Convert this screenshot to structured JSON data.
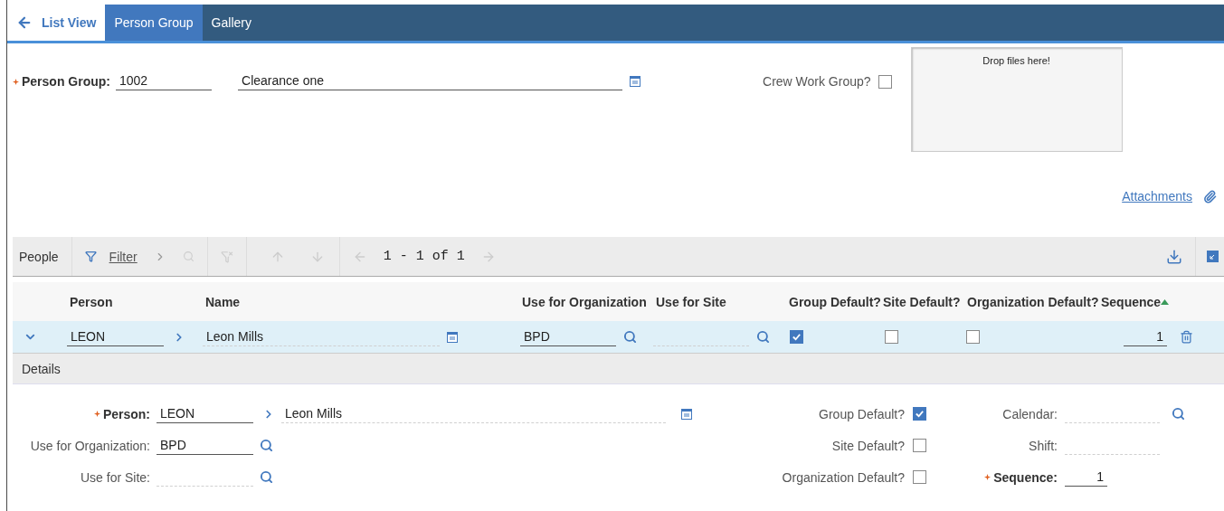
{
  "tabs": [
    {
      "kind": "back",
      "label": "List View",
      "selected": false
    },
    {
      "kind": "tab",
      "label": "Person Group",
      "selected": true
    },
    {
      "kind": "tab",
      "label": "Gallery",
      "selected": false
    }
  ],
  "header": {
    "person_group": {
      "label": "Person Group:",
      "required": true,
      "value": "1002"
    },
    "description": {
      "value": "Clearance one"
    },
    "crew_work_group": {
      "label": "Crew Work Group?",
      "checked": false
    },
    "drop_zone": {
      "text": "Drop files here!"
    },
    "attachments_link": "Attachments"
  },
  "people_table": {
    "title": "People",
    "filter_label": "Filter",
    "pagination": "1 - 1 of 1",
    "columns": [
      {
        "label": "Person"
      },
      {
        "label": "Name"
      },
      {
        "label": "Use for Organization"
      },
      {
        "label": "Use for Site"
      },
      {
        "label": "Group Default?"
      },
      {
        "label": "Site Default?"
      },
      {
        "label": "Organization Default?"
      },
      {
        "label": "Sequence",
        "sorted_ascending": true
      }
    ],
    "rows": [
      {
        "expanded": true,
        "person": "LEON",
        "name": "Leon Mills",
        "use_for_organization": "BPD",
        "group_default": true,
        "site_default": false,
        "organization_default": false,
        "sequence": "1"
      }
    ]
  },
  "details": {
    "title": "Details",
    "left": [
      {
        "kind": "person",
        "label": "Person:",
        "required": true,
        "value": "LEON",
        "name": "Leon Mills"
      },
      {
        "kind": "lookup",
        "label": "Use for Organization:",
        "required": false,
        "value": "BPD"
      },
      {
        "kind": "lookup",
        "label": "Use for Site:",
        "required": false
      }
    ],
    "checks": [
      {
        "label": "Group Default?",
        "checked": true
      },
      {
        "label": "Site Default?",
        "checked": false
      },
      {
        "label": "Organization Default?",
        "checked": false
      }
    ],
    "right": [
      {
        "kind": "lookup",
        "label": "Calendar:",
        "required": false
      },
      {
        "kind": "text",
        "label": "Shift:",
        "required": false
      },
      {
        "kind": "number",
        "label": "Sequence:",
        "required": true,
        "value": "1"
      }
    ]
  }
}
